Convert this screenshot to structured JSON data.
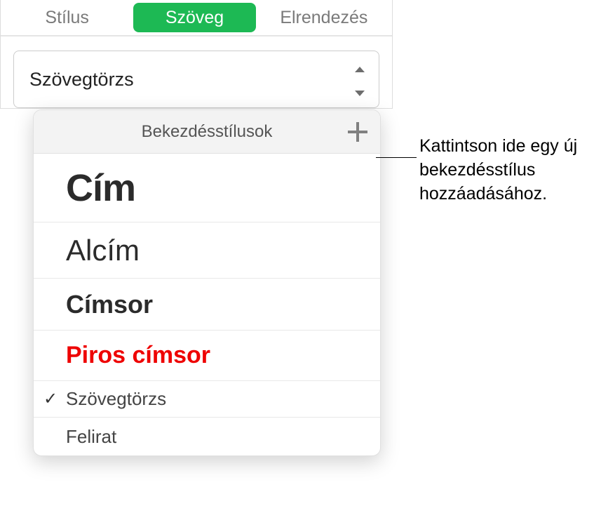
{
  "tabs": {
    "style": "Stílus",
    "text": "Szöveg",
    "layout": "Elrendezés"
  },
  "dropdown": {
    "selected": "Szövegtörzs"
  },
  "popover": {
    "title": "Bekezdésstílusok",
    "styles": [
      {
        "label": "Cím",
        "checked": false
      },
      {
        "label": "Alcím",
        "checked": false
      },
      {
        "label": "Címsor",
        "checked": false
      },
      {
        "label": "Piros címsor",
        "checked": false
      },
      {
        "label": "Szövegtörzs",
        "checked": true
      },
      {
        "label": "Felirat",
        "checked": false
      }
    ]
  },
  "callout": {
    "text": "Kattintson ide egy új bekezdésstílus hozzáadásához."
  },
  "icons": {
    "plus": "plus-icon",
    "caret": "caret-icon",
    "check": "✓"
  }
}
